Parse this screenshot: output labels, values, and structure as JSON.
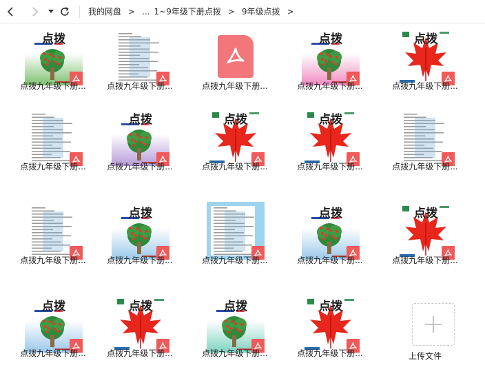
{
  "toolbar": {
    "breadcrumbs": [
      "我的网盘",
      "...",
      "1~9年级下册点拨",
      "9年级点拨"
    ],
    "separator": ">"
  },
  "cover_text": "点拨",
  "files": [
    {
      "name": "点拨九年级下册...",
      "cover": "tree-green"
    },
    {
      "name": "点拨九年级下册...",
      "cover": "doc-watermark"
    },
    {
      "name": "点拨九年级下册...",
      "cover": "pdf-generic"
    },
    {
      "name": "点拨九年级下册...",
      "cover": "tree-pink"
    },
    {
      "name": "点拨九年级下册...",
      "cover": "maple"
    },
    {
      "name": "点拨九年级下册...",
      "cover": "doc-watermark"
    },
    {
      "name": "点拨九年级下册...",
      "cover": "tree-purple"
    },
    {
      "name": "点拨九年级下册...",
      "cover": "maple"
    },
    {
      "name": "点拨九年级下册...",
      "cover": "maple"
    },
    {
      "name": "点拨九年级下册...",
      "cover": "doc-watermark"
    },
    {
      "name": "点拨九年级下册...",
      "cover": "doc-watermark"
    },
    {
      "name": "点拨九年级下册...",
      "cover": "tree-blue"
    },
    {
      "name": "点拨九年级下册...",
      "cover": "doc-blue"
    },
    {
      "name": "点拨九年级下册...",
      "cover": "tree-blue"
    },
    {
      "name": "点拨九年级下册...",
      "cover": "maple"
    },
    {
      "name": "点拨九年级下册...",
      "cover": "tree-blue"
    },
    {
      "name": "点拨九年级下册...",
      "cover": "maple"
    },
    {
      "name": "点拨九年级下册...",
      "cover": "tree-teal"
    },
    {
      "name": "点拨九年级下册...",
      "cover": "maple"
    }
  ],
  "upload": {
    "label": "上传文件"
  },
  "colors": {
    "pdf_badge": "#f05a5a",
    "pdf_generic": "#f2767a",
    "maple": "#e8261c"
  }
}
